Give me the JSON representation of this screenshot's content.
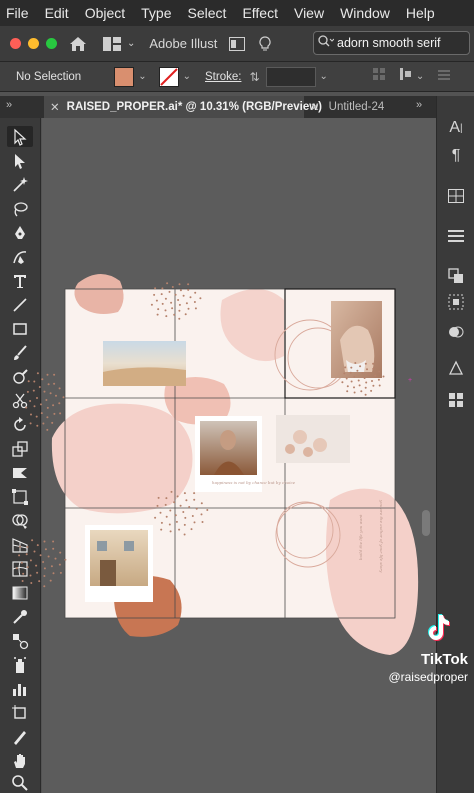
{
  "menubar": {
    "items": [
      "File",
      "Edit",
      "Object",
      "Type",
      "Select",
      "Effect",
      "View",
      "Window",
      "Help"
    ]
  },
  "appbar": {
    "app_name": "Adobe Illust",
    "search_value": "adorn smooth serif",
    "icons": [
      "home-icon",
      "workspace-icon",
      "chevron-down-icon",
      "screen-mode-icon",
      "lightbulb-icon",
      "search-icon"
    ]
  },
  "controlbar": {
    "selection_label": "No Selection",
    "stroke_label": "Stroke:",
    "fill_color": "#d98f6f",
    "stroke_color": "#ffffff"
  },
  "tabs": [
    {
      "label": "RAISED_PROPER.ai* @ 10.31% (RGB/Preview)",
      "active": true
    },
    {
      "label": "Untitled-24",
      "active": false
    }
  ],
  "tools": [
    "selection-tool-icon",
    "direct-selection-tool-icon",
    "magic-wand-icon",
    "lasso-icon",
    "pen-tool-icon",
    "curvature-tool-icon",
    "type-tool-icon",
    "line-tool-icon",
    "rectangle-tool-icon",
    "paintbrush-icon",
    "shaper-tool-icon",
    "scissors-icon",
    "rotate-tool-icon",
    "scale-tool-icon",
    "width-tool-icon",
    "free-transform-icon",
    "shape-builder-icon",
    "perspective-grid-icon",
    "mesh-tool-icon",
    "gradient-tool-icon",
    "eyedropper-icon",
    "blend-tool-icon",
    "symbol-sprayer-icon",
    "column-graph-icon",
    "artboard-tool-icon",
    "slice-tool-icon",
    "hand-tool-icon",
    "zoom-tool-icon"
  ],
  "right_panel": [
    "character-icon",
    "paragraph-icon",
    "transform-icon",
    "align-icon",
    "pathfinder-icon",
    "layers-icon",
    "appearance-icon",
    "graphic-styles-icon",
    "swatches-icon"
  ],
  "artboard": {
    "caption_1": "happiness is not by chance but by choice",
    "caption_2": "build the life you want",
    "caption_3": "you are the author of your life story"
  },
  "colors": {
    "blob_pink": "#f3cfc8",
    "blob_terracotta": "#c6734f",
    "blob_peach": "#e3a493",
    "dots": "#b5826c"
  },
  "watermark": {
    "brand": "TikTok",
    "handle": "@raisedproper"
  }
}
